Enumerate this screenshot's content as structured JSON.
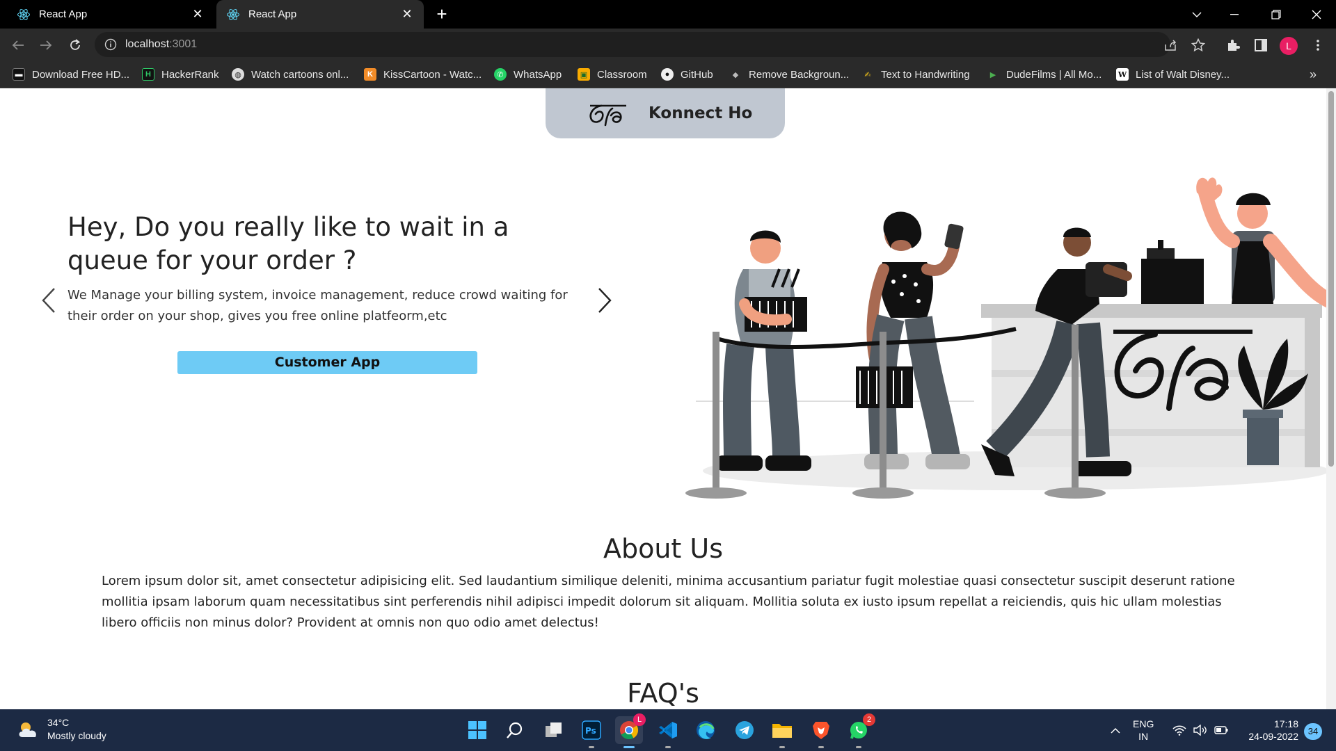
{
  "browser": {
    "tabs": [
      {
        "title": "React App",
        "active": false
      },
      {
        "title": "React App",
        "active": true
      }
    ],
    "address": {
      "host": "localhost",
      "port": ":3001"
    },
    "profile_initial": "L",
    "bookmarks": [
      {
        "label": "Download Free HD...",
        "icon": "download-icon"
      },
      {
        "label": "HackerRank",
        "icon": "hackerrank-icon"
      },
      {
        "label": "Watch cartoons onl...",
        "icon": "globe-icon"
      },
      {
        "label": "KissCartoon - Watc...",
        "icon": "kisscartoon-icon"
      },
      {
        "label": "WhatsApp",
        "icon": "whatsapp-icon"
      },
      {
        "label": "Classroom",
        "icon": "classroom-icon"
      },
      {
        "label": "GitHub",
        "icon": "github-icon"
      },
      {
        "label": "Remove Backgroun...",
        "icon": "remove-bg-icon"
      },
      {
        "label": "Text to Handwriting",
        "icon": "handwriting-icon"
      },
      {
        "label": "DudeFilms | All Mo...",
        "icon": "play-icon"
      },
      {
        "label": "List of Walt Disney...",
        "icon": "wikipedia-icon"
      }
    ]
  },
  "page": {
    "brand": "Konnect Ho",
    "hero": {
      "title": "Hey, Do you really like to wait in a queue for your order ?",
      "description": "We Manage your billing system, invoice management, reduce crowd waiting for their order on your shop, gives you free online platfeorm,etc",
      "cta_label": "Customer App"
    },
    "about": {
      "title": "About Us",
      "text": "Lorem ipsum dolor sit, amet consectetur adipisicing elit. Sed laudantium similique deleniti, minima accusantium pariatur fugit molestiae quasi consectetur suscipit deserunt ratione mollitia ipsam laborum quam necessitatibus sint perferendis nihil adipisci impedit dolorum sit aliquam. Mollitia soluta ex iusto ipsum repellat a reiciendis, quis hic ullam molestias libero officiis non minus dolor? Provident at omnis non quo odio amet delectus!"
    },
    "faq": {
      "title": "FAQ's"
    }
  },
  "taskbar": {
    "weather": {
      "temp": "34°C",
      "condition": "Mostly cloudy"
    },
    "apps": [
      "start-icon",
      "search-icon",
      "task-view-icon",
      "photoshop-icon",
      "chrome-icon",
      "vscode-icon",
      "edge-icon",
      "telegram-icon",
      "file-explorer-icon",
      "brave-icon",
      "whatsapp-icon"
    ],
    "chrome_badge": "L",
    "whatsapp_badge": "2",
    "language": {
      "line1": "ENG",
      "line2": "IN"
    },
    "clock": {
      "time": "17:18",
      "date": "24-09-2022"
    },
    "notifications": "34"
  },
  "colors": {
    "cta": "#6ecbf5",
    "nav_pill": "#c0c7d1",
    "taskbar": "#1c2a44"
  }
}
